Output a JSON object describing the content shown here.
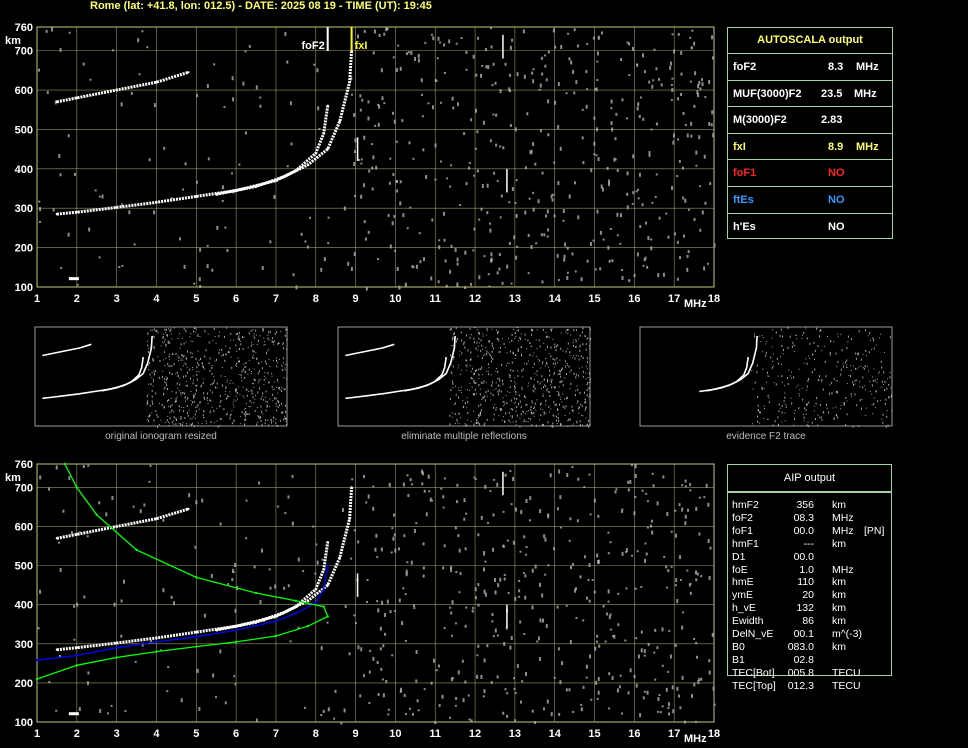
{
  "header": "Rome (lat: +41.8, lon: 012.5) - DATE: 2025 08 19 - TIME (UT): 19:45",
  "colors": {
    "background": "#000000",
    "grid": "#c8c87a",
    "trace": "#ffffff",
    "noise": "#b0b0b0",
    "header_text": "#ffff66",
    "fxI_marker": "#ffff00",
    "model_profile": "#00ff00",
    "aip_fit": "#0000ff",
    "no_color_foF1": "#ff2222",
    "no_color_ftEs": "#3399ff"
  },
  "main_ionogram": {
    "y_unit": "km",
    "x_unit": "MHz",
    "markers": [
      {
        "label": "foF2",
        "freq": 8.3
      },
      {
        "label": "fxI",
        "freq": 8.9
      }
    ]
  },
  "thumbnails": [
    {
      "caption": "original ionogram resized"
    },
    {
      "caption": "eliminate multiple reflections"
    },
    {
      "caption": "evidence F2 trace"
    }
  ],
  "autoscala": {
    "title": "AUTOSCALA output",
    "rows": [
      {
        "label": "foF2",
        "value": "8.3",
        "unit": "MHz",
        "label_color": "#ffffff",
        "value_color": "#ffffff"
      },
      {
        "label": "MUF(3000)F2",
        "value": "23.5",
        "unit": "MHz",
        "label_color": "#ffffff",
        "value_color": "#ffffff"
      },
      {
        "label": "M(3000)F2",
        "value": "2.83",
        "unit": "",
        "label_color": "#ffffff",
        "value_color": "#ffffff"
      },
      {
        "label": "fxI",
        "value": "8.9",
        "unit": "MHz",
        "label_color": "#ffff66",
        "value_color": "#ffff66"
      },
      {
        "label": "foF1",
        "value": "NO",
        "unit": "",
        "label_color": "#ff2222",
        "value_color": "#ff2222"
      },
      {
        "label": "ftEs",
        "value": "NO",
        "unit": "",
        "label_color": "#3399ff",
        "value_color": "#3399ff"
      },
      {
        "label": "h'Es",
        "value": "NO",
        "unit": "",
        "label_color": "#ffffff",
        "value_color": "#ffffff"
      }
    ]
  },
  "aip": {
    "title": "AIP output",
    "rows": [
      {
        "name": "hmF2",
        "value": "356",
        "unit": "km",
        "extra": ""
      },
      {
        "name": "foF2",
        "value": "08.3",
        "unit": "MHz",
        "extra": ""
      },
      {
        "name": "foF1",
        "value": "00.0",
        "unit": "MHz",
        "extra": "[PN]"
      },
      {
        "name": "hmF1",
        "value": "---",
        "unit": "km",
        "extra": ""
      },
      {
        "name": "D1",
        "value": "00.0",
        "unit": "",
        "extra": ""
      },
      {
        "name": "foE",
        "value": "1.0",
        "unit": "MHz",
        "extra": ""
      },
      {
        "name": "hmE",
        "value": "110",
        "unit": "km",
        "extra": ""
      },
      {
        "name": "ymE",
        "value": "20",
        "unit": "km",
        "extra": ""
      },
      {
        "name": "h_vE",
        "value": "132",
        "unit": "km",
        "extra": ""
      },
      {
        "name": "Ewidth",
        "value": "86",
        "unit": "km",
        "extra": ""
      },
      {
        "name": "DelN_vE",
        "value": "00.1",
        "unit": "m^(-3)",
        "extra": ""
      },
      {
        "name": "B0",
        "value": "083.0",
        "unit": "km",
        "extra": ""
      },
      {
        "name": "B1",
        "value": "02.8",
        "unit": "",
        "extra": ""
      },
      {
        "name": "TEC[Bot]",
        "value": "005.8",
        "unit": "TECU",
        "extra": ""
      },
      {
        "name": "TEC[Top]",
        "value": "012.3",
        "unit": "TECU",
        "extra": ""
      }
    ]
  },
  "chart_data": [
    {
      "type": "scatter",
      "name": "main ionogram",
      "x_ticks": [
        1,
        2,
        3,
        4,
        5,
        6,
        7,
        8,
        9,
        10,
        11,
        12,
        13,
        14,
        15,
        16,
        17,
        18
      ],
      "y_ticks": [
        100,
        200,
        300,
        400,
        500,
        600,
        700,
        760
      ],
      "xlim": [
        1,
        18
      ],
      "ylim": [
        100,
        760
      ],
      "xlabel": "MHz",
      "ylabel": "km",
      "grid": true,
      "series": [
        {
          "values": [
            [
              1.5,
              285
            ],
            [
              2,
              290
            ],
            [
              3,
              302
            ],
            [
              4,
              315
            ],
            [
              5,
              330
            ],
            [
              6,
              345
            ],
            [
              7,
              370
            ],
            [
              7.5,
              395
            ],
            [
              8,
              440
            ],
            [
              8.2,
              490
            ],
            [
              8.3,
              560
            ]
          ]
        },
        {
          "values": [
            [
              5.5,
              335
            ],
            [
              6.5,
              355
            ],
            [
              7.2,
              380
            ],
            [
              7.8,
              410
            ],
            [
              8.3,
              450
            ],
            [
              8.6,
              520
            ],
            [
              8.85,
              620
            ],
            [
              8.9,
              700
            ]
          ]
        },
        {
          "values": [
            [
              1.5,
              570
            ],
            [
              2,
              580
            ],
            [
              3,
              600
            ],
            [
              4,
              620
            ],
            [
              4.8,
              645
            ]
          ]
        }
      ]
    },
    {
      "type": "line",
      "name": "AIP fit",
      "x_ticks": [
        1,
        2,
        3,
        4,
        5,
        6,
        7,
        8,
        9,
        10,
        11,
        12,
        13,
        14,
        15,
        16,
        17,
        18
      ],
      "y_ticks": [
        100,
        200,
        300,
        400,
        500,
        600,
        700,
        760
      ],
      "xlim": [
        1,
        18
      ],
      "ylim": [
        100,
        760
      ],
      "xlabel": "MHz",
      "ylabel": "km",
      "grid": true,
      "series": [
        {
          "values": [
            [
              1.5,
              285
            ],
            [
              2,
              290
            ],
            [
              3,
              302
            ],
            [
              4,
              315
            ],
            [
              5,
              330
            ],
            [
              6,
              345
            ],
            [
              7,
              370
            ],
            [
              7.5,
              395
            ],
            [
              8,
              440
            ],
            [
              8.2,
              490
            ],
            [
              8.3,
              560
            ]
          ]
        },
        {
          "values": [
            [
              5.5,
              335
            ],
            [
              6.5,
              355
            ],
            [
              7.2,
              380
            ],
            [
              7.8,
              410
            ],
            [
              8.3,
              450
            ],
            [
              8.6,
              520
            ],
            [
              8.85,
              620
            ],
            [
              8.9,
              700
            ]
          ]
        },
        {
          "values": [
            [
              1.5,
              570
            ],
            [
              2,
              580
            ],
            [
              3,
              600
            ],
            [
              4,
              620
            ],
            [
              4.8,
              645
            ]
          ]
        },
        {
          "values": [
            [
              1,
              258
            ],
            [
              2,
              270
            ],
            [
              3,
              290
            ],
            [
              4,
              305
            ],
            [
              5,
              318
            ],
            [
              6,
              335
            ],
            [
              7,
              358
            ],
            [
              7.5,
              378
            ],
            [
              8,
              405
            ],
            [
              8.2,
              440
            ],
            [
              8.3,
              500
            ]
          ]
        },
        {
          "values": [
            [
              1,
              210
            ],
            [
              2,
              245
            ],
            [
              3,
              265
            ],
            [
              4,
              280
            ],
            [
              5,
              293
            ],
            [
              6,
              305
            ],
            [
              7,
              320
            ],
            [
              7.8,
              345
            ],
            [
              8.3,
              370
            ],
            [
              8.2,
              395
            ],
            [
              7.5,
              410
            ],
            [
              6.5,
              430
            ],
            [
              5,
              470
            ],
            [
              3.5,
              540
            ],
            [
              2.5,
              630
            ],
            [
              2,
              700
            ],
            [
              1.7,
              760
            ]
          ]
        }
      ]
    }
  ]
}
